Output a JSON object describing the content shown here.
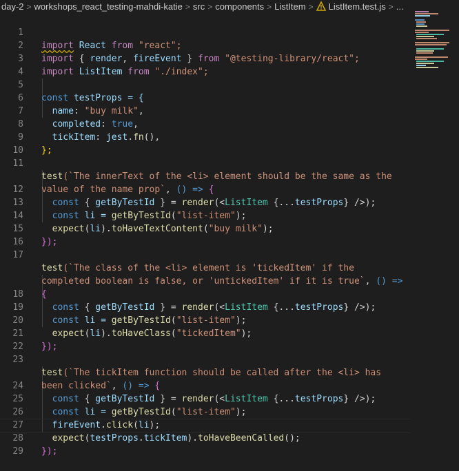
{
  "breadcrumbs": {
    "items": [
      "day-2",
      "workshops_react_testing-mahdi-katie",
      "src",
      "components",
      "ListItem",
      "ListItem.test.js",
      "..."
    ],
    "separator": ">"
  },
  "editor": {
    "lines": [
      {
        "n": "1"
      },
      {
        "n": "2"
      },
      {
        "n": "3"
      },
      {
        "n": "4"
      },
      {
        "n": "5"
      },
      {
        "n": "6"
      },
      {
        "n": "7"
      },
      {
        "n": "8"
      },
      {
        "n": "9"
      },
      {
        "n": "10"
      },
      {
        "n": "11"
      },
      {
        "n": ""
      },
      {
        "n": "12"
      },
      {
        "n": "13"
      },
      {
        "n": "14"
      },
      {
        "n": "15"
      },
      {
        "n": "16"
      },
      {
        "n": "17"
      },
      {
        "n": ""
      },
      {
        "n": ""
      },
      {
        "n": "18"
      },
      {
        "n": "19"
      },
      {
        "n": "20"
      },
      {
        "n": "21"
      },
      {
        "n": "22"
      },
      {
        "n": "23"
      },
      {
        "n": ""
      },
      {
        "n": "24"
      },
      {
        "n": "25"
      },
      {
        "n": "26"
      },
      {
        "n": "27"
      },
      {
        "n": "28"
      },
      {
        "n": "29"
      }
    ],
    "tokens": {
      "l1": [
        "import",
        " React ",
        "from",
        " \"react\";"
      ],
      "l2": [
        "import",
        " { ",
        "render",
        ", ",
        "fireEvent",
        " } ",
        "from",
        " \"@testing-library/react\";"
      ],
      "l3": [
        "import",
        " ListItem ",
        "from",
        " \"./index\";"
      ],
      "l5": [
        "const",
        " testProps = {"
      ],
      "l6": [
        "  name",
        ": ",
        "\"buy milk\"",
        ","
      ],
      "l7": [
        "  completed",
        ": ",
        "true",
        ","
      ],
      "l8": [
        "  tickItem",
        ": ",
        "jest",
        ".",
        "fn",
        "(),"
      ],
      "l9": [
        "};"
      ],
      "l11a": [
        "test",
        "(`The innerText of the <li> element should be the same as the"
      ],
      "l11b": [
        "value of the name prop`",
        ", ",
        "() =>",
        " {"
      ],
      "l12": [
        "  const",
        " { ",
        "getByTestId",
        " } = ",
        "render",
        "(<",
        "ListItem",
        " {...",
        "testProps",
        "} />);"
      ],
      "l13": [
        "  const",
        " li = ",
        "getByTestId",
        "(",
        "\"list-item\"",
        ");"
      ],
      "l14": [
        "  expect",
        "(",
        "li",
        ").",
        "toHaveTextContent",
        "(",
        "\"buy milk\"",
        ");"
      ],
      "l15": [
        "});"
      ],
      "l17a": [
        "test",
        "(`The class of the <li> element is 'tickedItem' if the"
      ],
      "l17b": [
        "completed boolean is false, or 'untickedItem' if it is true`",
        ", ",
        "() =>"
      ],
      "l17c": [
        "{"
      ],
      "l18": [
        "  const",
        " { ",
        "getByTestId",
        " } = ",
        "render",
        "(<",
        "ListItem",
        " {...",
        "testProps",
        "} />);"
      ],
      "l19": [
        "  const",
        " li = ",
        "getByTestId",
        "(",
        "\"list-item\"",
        ");"
      ],
      "l20": [
        "  expect",
        "(",
        "li",
        ").",
        "toHaveClass",
        "(",
        "\"tickedItem\"",
        ");"
      ],
      "l21": [
        "});"
      ],
      "l23a": [
        "test",
        "(`The tickItem function should be called after the <li> has"
      ],
      "l23b": [
        "been clicked`",
        ", ",
        "() =>",
        " {"
      ],
      "l24": [
        "  const",
        " { ",
        "getByTestId",
        " } = ",
        "render",
        "(<",
        "ListItem",
        " {...",
        "testProps",
        "} />);"
      ],
      "l25": [
        "  const",
        " li = ",
        "getByTestId",
        "(",
        "\"list-item\"",
        ");"
      ],
      "l26": [
        "  fireEvent",
        ".",
        "click",
        "(",
        "li",
        ");"
      ],
      "l27": [
        "  expect",
        "(",
        "testProps",
        ".",
        "tickItem",
        ").",
        "toHaveBeenCalled",
        "();"
      ],
      "l28": [
        "});"
      ]
    }
  },
  "colors": {
    "keyword": "#c586c0",
    "string": "#ce9178",
    "function": "#dcdcaa",
    "variable": "#9cdcfe",
    "declaration": "#569cd6",
    "component": "#4ec9b0",
    "bracket_gold": "#ffd700",
    "bracket_pink": "#da70d6"
  }
}
